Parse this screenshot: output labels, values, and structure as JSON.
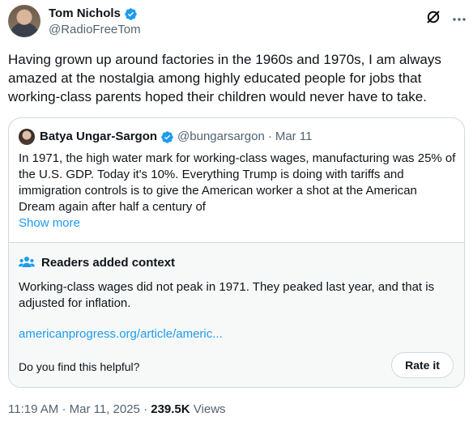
{
  "tweet": {
    "author_name": "Tom Nichols",
    "handle": "@RadioFreeTom",
    "text": "Having grown up around factories in the 1960s and 1970s, I am always amazed at the nostalgia among highly educated people for jobs that working-class parents hoped their children would never have to take.",
    "time": "11:19 AM",
    "sep1": "·",
    "date": "Mar 11, 2025",
    "sep2": "·",
    "views_count": "239.5K",
    "views_label": "Views"
  },
  "quoted": {
    "author_name": "Batya Ungar-Sargon",
    "handle": "@bungarsargon",
    "sep": "·",
    "date": "Mar 11",
    "text": "In 1971, the high water mark for working-class wages, manufacturing was 25% of the U.S. GDP. Today it's 10%. Everything Trump is doing with tariffs and immigration controls is to give the American worker a shot at the American Dream again after half a century of",
    "show_more": "Show more"
  },
  "context": {
    "title": "Readers added context",
    "text": "Working-class wages did not peak in 1971. They peaked last year, and that is adjusted for inflation.",
    "link": "americanprogress.org/article/americ...",
    "question": "Do you find this helpful?",
    "rate_label": "Rate it"
  },
  "icons": {
    "verified": "verified-badge-icon",
    "grok": "grok-icon",
    "more": "more-icon",
    "readers": "people-icon"
  },
  "colors": {
    "accent": "#1d9bf0",
    "text": "#0f1419",
    "muted": "#536471",
    "border": "#cfd9de",
    "context_bg": "#f7f9f9"
  }
}
